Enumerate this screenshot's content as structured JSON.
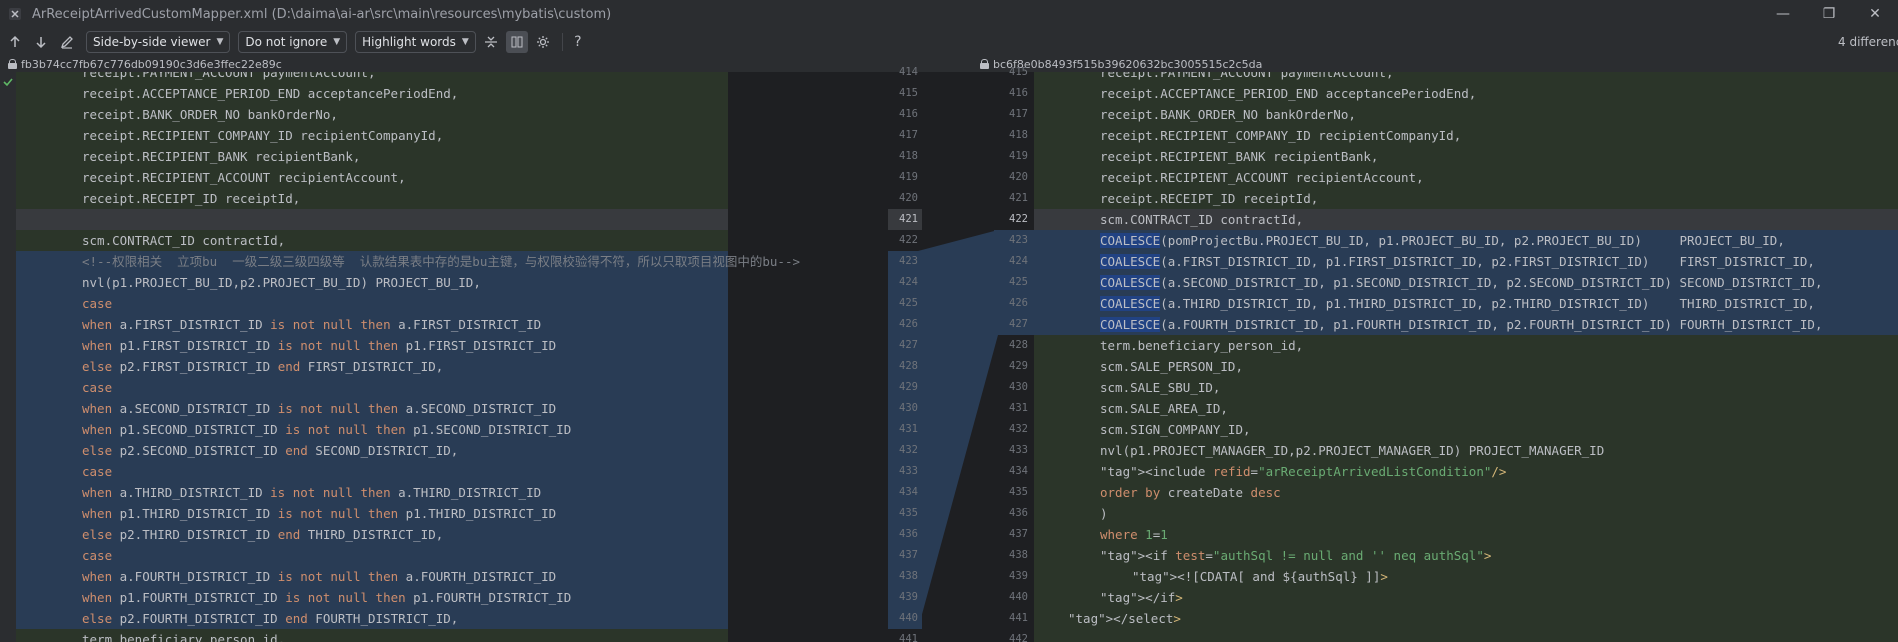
{
  "window": {
    "title": "ArReceiptArrivedCustomMapper.xml (D:\\daima\\ai-ar\\src\\main\\resources\\mybatis\\custom)",
    "minimize": "—",
    "maximize": "❐",
    "close": "✕"
  },
  "toolbar": {
    "viewer_mode": "Side-by-side viewer",
    "whitespace": "Do not ignore",
    "highlight": "Highlight words",
    "help": "?",
    "diff_count": "4 differences"
  },
  "revisions": {
    "left": "fb3b74cc7fb67c776db09190c3d6e3ffec22e89c",
    "right": "bc6f8e0b8493f515b39620632bc3005515c2c5da"
  },
  "colors": {
    "editor_bg": "#1e1f22",
    "changed_bg": "#293c55",
    "modified_bg": "#2f3a2a",
    "selection": "#214283",
    "keyword": "#cf8e6d",
    "string": "#6aab73",
    "tag": "#d5b778"
  },
  "left_lines": [
    "receipt.PAYMENT_ACCOUNT paymentAccount,",
    "receipt.ACCEPTANCE_PERIOD_END acceptancePeriodEnd,",
    "receipt.BANK_ORDER_NO bankOrderNo,",
    "receipt.RECIPIENT_COMPANY_ID recipientCompanyId,",
    "receipt.RECIPIENT_BANK recipientBank,",
    "receipt.RECIPIENT_ACCOUNT recipientAccount,",
    "receipt.RECEIPT_ID receiptId,",
    "",
    "scm.CONTRACT_ID contractId,",
    "<!--权限相关  立项bu  一级二级三级四级等  认款结果表中存的是bu主键，与权限校验得不符，所以只取项目视图中的bu-->",
    "nvl(p1.PROJECT_BU_ID,p2.PROJECT_BU_ID) PROJECT_BU_ID,",
    "case",
    "when a.FIRST_DISTRICT_ID is not null then a.FIRST_DISTRICT_ID",
    "when p1.FIRST_DISTRICT_ID is not null then p1.FIRST_DISTRICT_ID",
    "else p2.FIRST_DISTRICT_ID end FIRST_DISTRICT_ID,",
    "case",
    "when a.SECOND_DISTRICT_ID is not null then a.SECOND_DISTRICT_ID",
    "when p1.SECOND_DISTRICT_ID is not null then p1.SECOND_DISTRICT_ID",
    "else p2.SECOND_DISTRICT_ID end SECOND_DISTRICT_ID,",
    "case",
    "when a.THIRD_DISTRICT_ID is not null then a.THIRD_DISTRICT_ID",
    "when p1.THIRD_DISTRICT_ID is not null then p1.THIRD_DISTRICT_ID",
    "else p2.THIRD_DISTRICT_ID end THIRD_DISTRICT_ID,",
    "case",
    "when a.FOURTH_DISTRICT_ID is not null then a.FOURTH_DISTRICT_ID",
    "when p1.FOURTH_DISTRICT_ID is not null then p1.FOURTH_DISTRICT_ID",
    "else p2.FOURTH_DISTRICT_ID end FOURTH_DISTRICT_ID,",
    "term.beneficiary_person_id,"
  ],
  "left_numbers": [
    "414",
    "415",
    "416",
    "417",
    "418",
    "419",
    "420",
    "421",
    "422",
    "423",
    "424",
    "425",
    "426",
    "427",
    "428",
    "429",
    "430",
    "431",
    "432",
    "433",
    "434",
    "435",
    "436",
    "437",
    "438",
    "439",
    "440",
    "441"
  ],
  "right_numbers": [
    "415",
    "416",
    "417",
    "418",
    "419",
    "420",
    "421",
    "422",
    "423",
    "424",
    "425",
    "426",
    "427",
    "428",
    "429",
    "430",
    "431",
    "432",
    "433",
    "434",
    "435",
    "436",
    "437",
    "438",
    "439",
    "440",
    "441",
    "442"
  ],
  "right_lines": [
    "receipt.PAYMENT_ACCOUNT paymentAccount,",
    "receipt.ACCEPTANCE_PERIOD_END acceptancePeriodEnd,",
    "receipt.BANK_ORDER_NO bankOrderNo,",
    "receipt.RECIPIENT_COMPANY_ID recipientCompanyId,",
    "receipt.RECIPIENT_BANK recipientBank,",
    "receipt.RECIPIENT_ACCOUNT recipientAccount,",
    "receipt.RECEIPT_ID receiptId,",
    "scm.CONTRACT_ID contractId,",
    "COALESCE(pomProjectBu.PROJECT_BU_ID, p1.PROJECT_BU_ID, p2.PROJECT_BU_ID)     PROJECT_BU_ID,",
    "COALESCE(a.FIRST_DISTRICT_ID, p1.FIRST_DISTRICT_ID, p2.FIRST_DISTRICT_ID)    FIRST_DISTRICT_ID,",
    "COALESCE(a.SECOND_DISTRICT_ID, p1.SECOND_DISTRICT_ID, p2.SECOND_DISTRICT_ID) SECOND_DISTRICT_ID,",
    "COALESCE(a.THIRD_DISTRICT_ID, p1.THIRD_DISTRICT_ID, p2.THIRD_DISTRICT_ID)    THIRD_DISTRICT_ID,",
    "COALESCE(a.FOURTH_DISTRICT_ID, p1.FOURTH_DISTRICT_ID, p2.FOURTH_DISTRICT_ID) FOURTH_DISTRICT_ID,",
    "term.beneficiary_person_id,",
    "scm.SALE_PERSON_ID,",
    "scm.SALE_SBU_ID,",
    "scm.SALE_AREA_ID,",
    "scm.SIGN_COMPANY_ID,",
    "nvl(p1.PROJECT_MANAGER_ID,p2.PROJECT_MANAGER_ID) PROJECT_MANAGER_ID",
    "<include refid=\"arReceiptArrivedListCondition\"/>",
    "order by createDate desc",
    ")",
    "where 1=1",
    "<if test=\"authSql != null and '' neq authSql\">",
    "<![CDATA[ and ${authSql} ]]>",
    "</if>",
    "</select>",
    ""
  ]
}
